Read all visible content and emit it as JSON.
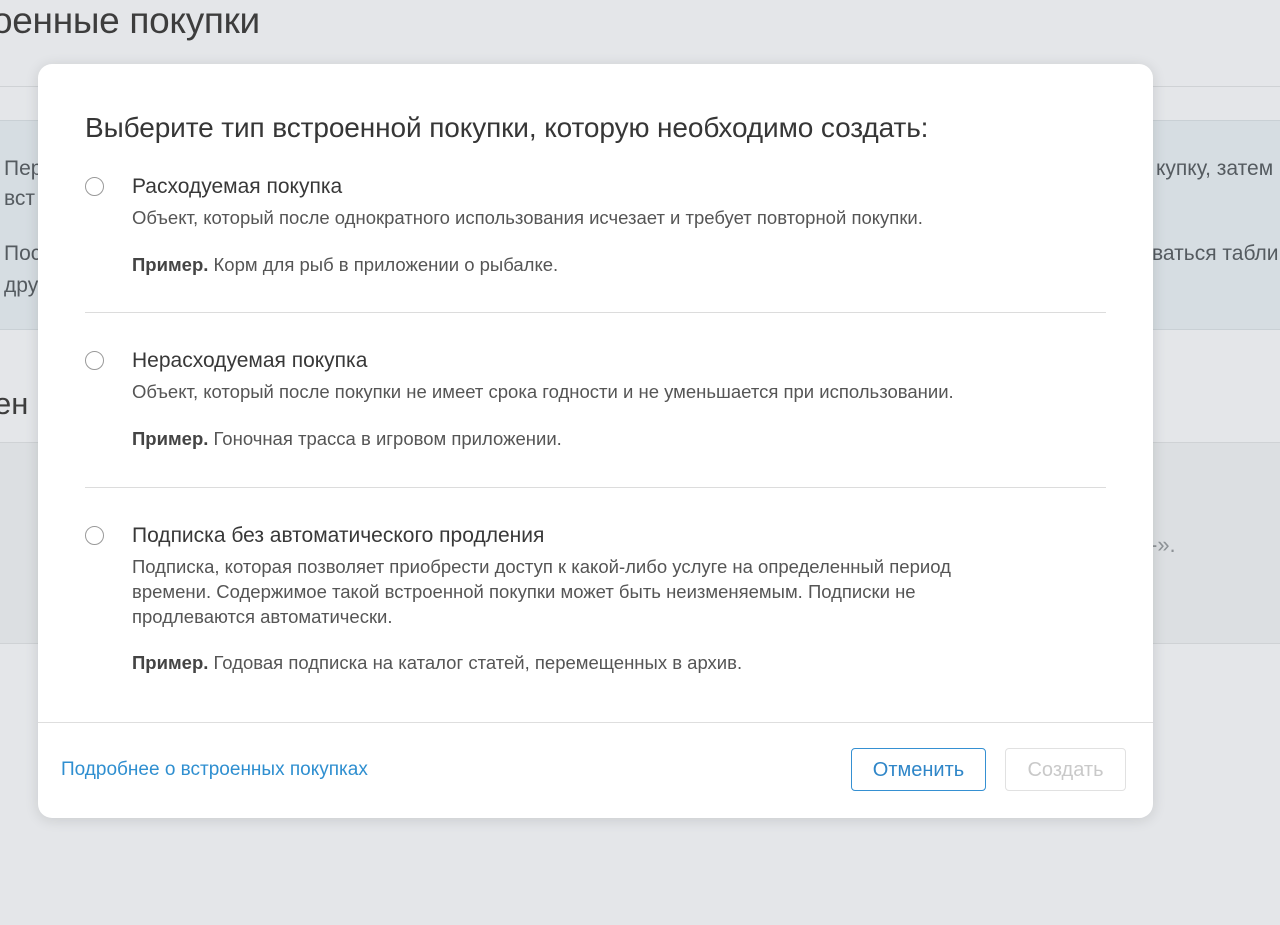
{
  "background": {
    "page_title": "оенные покупки",
    "info_lines": [
      {
        "left": "Пер",
        "right": "купку, затем"
      },
      {
        "left": "вст",
        "right": ""
      },
      {
        "left": "Пос",
        "right": "ваться табли"
      },
      {
        "left": "дру",
        "right": ""
      }
    ],
    "section_title": "ен",
    "quote_fragment": "-»."
  },
  "modal": {
    "title": "Выберите тип встроенной покупки, которую необходимо создать:",
    "options": [
      {
        "name": "Расходуемая покупка",
        "description": "Объект, который после однократного использования исчезает и требует повторной покупки.",
        "example_label": "Пример.",
        "example_text": " Корм для рыб в приложении о рыбалке."
      },
      {
        "name": "Нерасходуемая покупка",
        "description": "Объект, который после покупки не имеет срока годности и не уменьшается при использовании.",
        "example_label": "Пример.",
        "example_text": " Гоночная трасса в игровом приложении."
      },
      {
        "name": "Подписка без автоматического продления",
        "description": "Подписка, которая позволяет приобрести доступ к какой-либо услуге на определенный период времени. Содержимое такой встроенной покупки может быть неизменяемым. Подписки не продлеваются автоматически.",
        "example_label": "Пример.",
        "example_text": " Годовая подписка на каталог статей, перемещенных в архив."
      }
    ],
    "footer": {
      "learn_more_link": "Подробнее о встроенных покупках",
      "cancel_label": "Отменить",
      "create_label": "Создать"
    }
  },
  "colors": {
    "accent": "#2f8fd0",
    "background": "#e4e6e9",
    "info_panel": "#d6dde2",
    "disabled_text": "#c9c9c9"
  }
}
